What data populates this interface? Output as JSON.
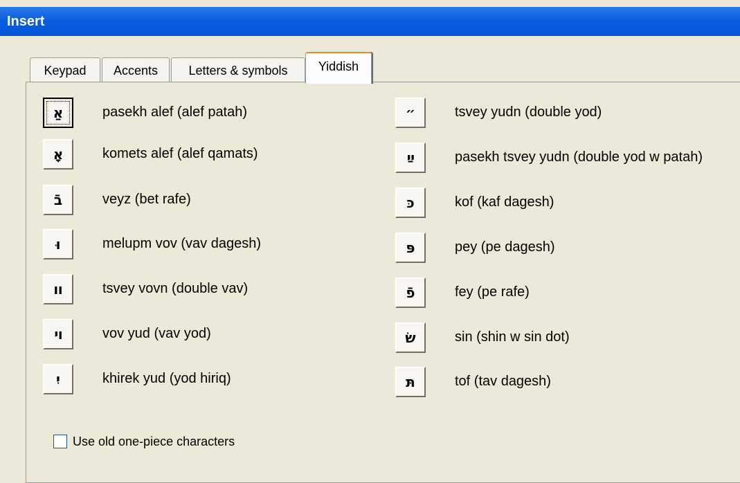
{
  "window": {
    "title": "Insert"
  },
  "tabs": [
    {
      "label": "Keypad",
      "active": false
    },
    {
      "label": "Accents",
      "active": false
    },
    {
      "label": "Letters & symbols",
      "active": false
    },
    {
      "label": "Yiddish",
      "active": true
    }
  ],
  "yiddish": {
    "left_column": [
      {
        "symbol": "אַ",
        "label": "pasekh alef (alef patah)",
        "focused": true
      },
      {
        "symbol": "אָ",
        "label": "komets alef (alef qamats)"
      },
      {
        "symbol": "בֿ",
        "label": "veyz (bet rafe)"
      },
      {
        "symbol": "וּ",
        "label": "melupm vov (vav dagesh)"
      },
      {
        "symbol": "װ",
        "label": "tsvey vovn (double vav)"
      },
      {
        "symbol": "ױ",
        "label": "vov yud (vav yod)"
      },
      {
        "symbol": "יִ",
        "label": "khirek yud (yod hiriq)"
      }
    ],
    "right_column": [
      {
        "symbol": "״",
        "label": "tsvey yudn (double yod)"
      },
      {
        "symbol": "ײַ",
        "label": "pasekh tsvey yudn (double yod w patah)"
      },
      {
        "symbol": "כּ",
        "label": "kof (kaf dagesh)"
      },
      {
        "symbol": "פּ",
        "label": "pey (pe dagesh)"
      },
      {
        "symbol": "פֿ",
        "label": "fey (pe rafe)"
      },
      {
        "symbol": "שׂ",
        "label": "sin (shin w sin dot)"
      },
      {
        "symbol": "תּ",
        "label": "tof (tav dagesh)"
      }
    ],
    "option": {
      "label": "Use old one-piece characters",
      "checked": false
    }
  }
}
